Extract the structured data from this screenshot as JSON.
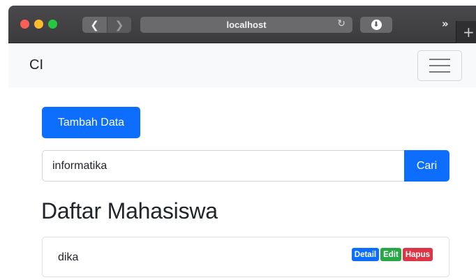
{
  "browser": {
    "back_icon": "chevron-left-icon",
    "back_glyph": "❮",
    "forward_icon": "chevron-right-icon",
    "forward_glyph": "❯",
    "address": "localhost",
    "reload_icon": "reload-icon",
    "reload_glyph": "↻",
    "download_icon": "download-icon",
    "download_glyph": "⬇",
    "overflow_icon": "chevron-double-right-icon",
    "overflow_glyph": "»",
    "newtab_icon": "plus-icon",
    "newtab_glyph": "+"
  },
  "navbar": {
    "brand": "CI",
    "toggler_icon": "hamburger-menu-icon"
  },
  "main": {
    "add_button_label": "Tambah Data",
    "search": {
      "value": "informatika",
      "button_label": "Cari"
    },
    "heading": "Daftar Mahasiswa",
    "items": [
      {
        "name": "dika",
        "actions": {
          "detail": "Detail",
          "edit": "Edit",
          "delete": "Hapus"
        }
      }
    ]
  },
  "colors": {
    "primary": "#0d6efd",
    "success": "#28a745",
    "danger": "#dc3545",
    "navbar_bg": "#f8f9fa"
  }
}
